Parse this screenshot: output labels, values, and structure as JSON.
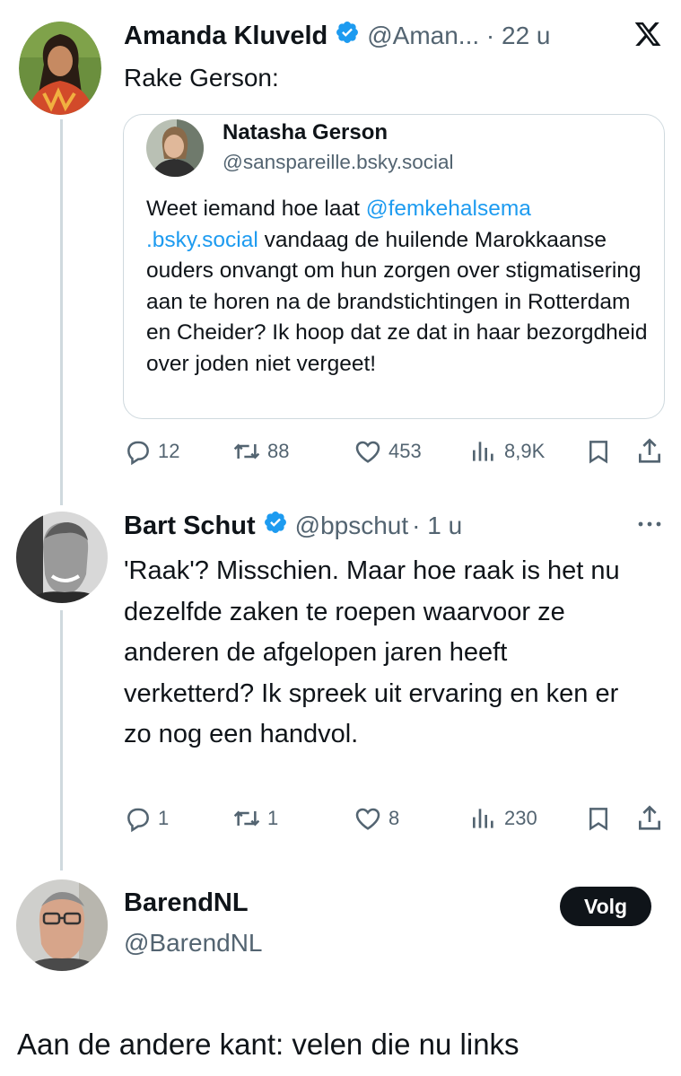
{
  "tweet1": {
    "author_name": "Amanda Kluveld",
    "handle_time": "@Aman... · 22 u",
    "text": "Rake Gerson:",
    "quote": {
      "author_name": "Natasha Gerson",
      "handle": "@sanspareille.bsky.social",
      "text_before": "Weet iemand hoe laat ",
      "mention": "@femkehalsema .bsky.social",
      "text_after": " vandaag de huilende Marokkaanse ouders onvangt om hun zorgen over stigmatisering aan te horen na de brandstichtingen in Rotterdam en Cheider? Ik hoop dat ze dat in haar bezorgdheid over joden niet vergeet!"
    },
    "actions": {
      "replies": "12",
      "reposts": "88",
      "likes": "453",
      "views": "8,9K"
    }
  },
  "tweet2": {
    "author_name": "Bart Schut",
    "handle": "@bpschut",
    "time": "· 1 u",
    "text": "'Raak'? Misschien. Maar hoe raak is het nu dezelfde zaken te roepen waarvoor ze anderen de afgelopen jaren heeft verketterd? Ik spreek uit ervaring en ken er zo nog een handvol.",
    "actions": {
      "replies": "1",
      "reposts": "1",
      "likes": "8",
      "views": "230"
    }
  },
  "tweet3": {
    "author_name": "BarendNL",
    "handle": "@BarendNL",
    "follow_label": "Volg",
    "text": "Aan de andere kant: velen die nu links"
  },
  "colors": {
    "link": "#1d9bf0",
    "verified": "#1d9bf0",
    "muted": "#536471",
    "text": "#0f1419",
    "border": "#cfd9de"
  },
  "icons": [
    "x-logo-icon",
    "verified-badge-icon",
    "reply-icon",
    "repost-icon",
    "like-icon",
    "views-icon",
    "bookmark-icon",
    "share-icon",
    "more-icon"
  ]
}
